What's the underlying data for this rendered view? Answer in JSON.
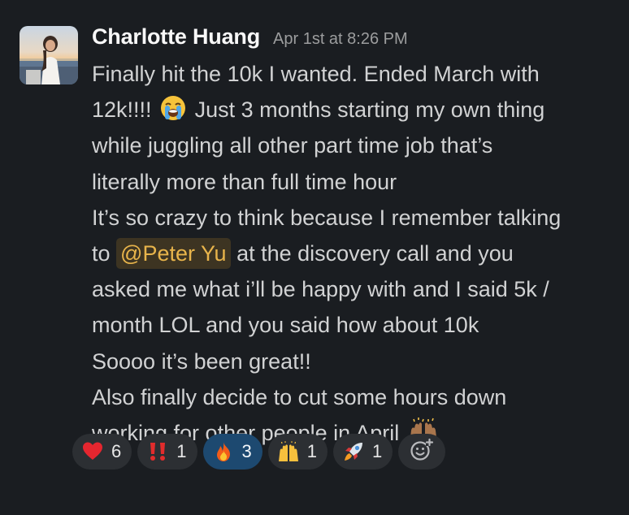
{
  "message": {
    "sender": "Charlotte Huang",
    "timestamp": "Apr 1st at 8:26 PM",
    "lines": {
      "l1": "Finally hit the 10k I wanted. Ended March with",
      "l2a": "12k!!!!",
      "l2b": "Just 3 months starting my own thing",
      "l3": "while juggling all other part time job that’s",
      "l4": "literally more than full time hour",
      "l5": "It’s so crazy to think because I remember talking",
      "l6a": "to",
      "l6mention": "@Peter Yu",
      "l6b": "at the discovery call and you",
      "l7": "asked me what i’ll be happy with and I said 5k /",
      "l8": "month LOL and you said how about 10k",
      "l9": "Soooo it’s been great!!",
      "l10": "Also finally decide to cut some hours down",
      "l11": "working for other people in April"
    },
    "inline_emojis": [
      "loudly-crying-face",
      "raising-hands"
    ]
  },
  "reactions": [
    {
      "icon": "red-heart",
      "count": "6",
      "active": false
    },
    {
      "icon": "double-exclamation",
      "count": "1",
      "active": false
    },
    {
      "icon": "fire",
      "count": "3",
      "active": true
    },
    {
      "icon": "raising-hands",
      "count": "1",
      "active": false
    },
    {
      "icon": "rocket",
      "count": "1",
      "active": false
    }
  ],
  "add_reaction_icon": "add-emoji-icon",
  "colors": {
    "background": "#1a1d21",
    "mention_text": "#e8b44b",
    "mention_bg": "#3d3422",
    "reaction_bg": "#2c2f33",
    "reaction_active_bg": "#1d4970"
  }
}
